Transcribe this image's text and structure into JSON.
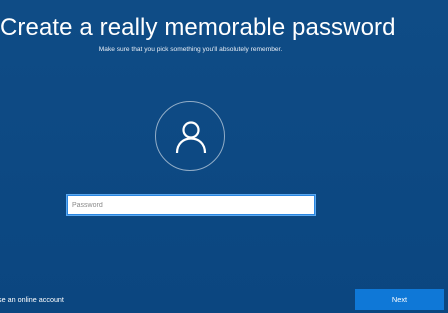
{
  "page": {
    "title": "Create a really memorable password",
    "subtitle": "Make sure that you pick something you'll absolutely remember."
  },
  "avatar": {
    "icon": "user-icon"
  },
  "password_field": {
    "value": "",
    "placeholder": "Password"
  },
  "footer": {
    "online_account_link": "use an online account",
    "next_label": "Next"
  },
  "colors": {
    "background": "#0d4a83",
    "accent": "#0f78d7",
    "input_border": "#2a86e0"
  }
}
